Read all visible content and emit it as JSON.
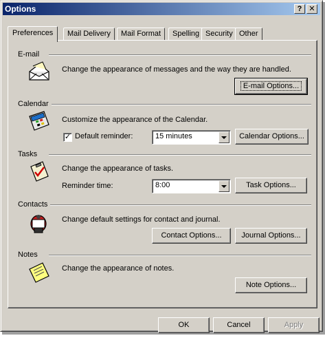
{
  "window": {
    "title": "Options",
    "help_label": "?",
    "close_label": "✕"
  },
  "tabs": [
    {
      "label": "Preferences",
      "active": true
    },
    {
      "label": "Mail Delivery",
      "active": false
    },
    {
      "label": "Mail Format",
      "active": false
    },
    {
      "label": "Spelling",
      "active": false
    },
    {
      "label": "Security",
      "active": false
    },
    {
      "label": "Other",
      "active": false
    }
  ],
  "email": {
    "heading": "E-mail",
    "description": "Change the appearance of messages and the way they are handled.",
    "button": "E-mail Options...",
    "icon": "envelope-icon"
  },
  "calendar": {
    "heading": "Calendar",
    "description": "Customize the appearance of the Calendar.",
    "reminder_label": "Default reminder:",
    "reminder_checked": true,
    "reminder_value": "15 minutes",
    "button": "Calendar Options...",
    "icon": "calendar-icon"
  },
  "tasks": {
    "heading": "Tasks",
    "description": "Change the appearance of tasks.",
    "reminder_label": "Reminder time:",
    "reminder_value": "8:00",
    "button": "Task Options...",
    "icon": "clipboard-check-icon"
  },
  "contacts": {
    "heading": "Contacts",
    "description": "Change default settings for contact and journal.",
    "contact_button": "Contact Options...",
    "journal_button": "Journal Options...",
    "icon": "rolodex-icon"
  },
  "notes": {
    "heading": "Notes",
    "description": "Change the appearance of notes.",
    "button": "Note Options...",
    "icon": "sticky-note-icon"
  },
  "footer": {
    "ok": "OK",
    "cancel": "Cancel",
    "apply": "Apply",
    "apply_enabled": false
  }
}
